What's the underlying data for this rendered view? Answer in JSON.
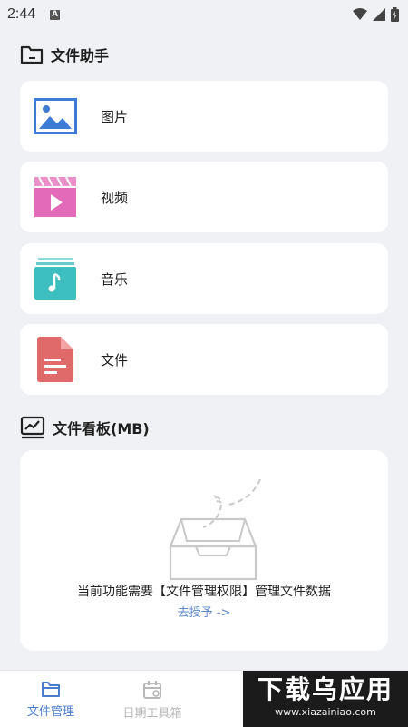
{
  "status": {
    "time": "2:44",
    "notif_letter": "A"
  },
  "files_section": {
    "title": "文件助手"
  },
  "categories": [
    {
      "label": "图片",
      "icon": "image-icon"
    },
    {
      "label": "视频",
      "icon": "video-icon"
    },
    {
      "label": "音乐",
      "icon": "music-icon"
    },
    {
      "label": "文件",
      "icon": "document-icon"
    }
  ],
  "board": {
    "title": "文件看板(MB)",
    "message": "当前功能需要【文件管理权限】管理文件数据",
    "grant_link": "去授予 ->"
  },
  "tabs": [
    {
      "label": "文件管理",
      "active": true
    },
    {
      "label": "日期工具箱",
      "active": false
    }
  ],
  "watermark": {
    "main": "下载乌应用",
    "url": "www.xiazainiao.com"
  },
  "colors": {
    "accent": "#4a7ccc",
    "image_icon": "#3d7bd6",
    "video_icon": "#e36ab8",
    "music_icon": "#3dbfbf",
    "document_icon": "#e06a6a"
  }
}
